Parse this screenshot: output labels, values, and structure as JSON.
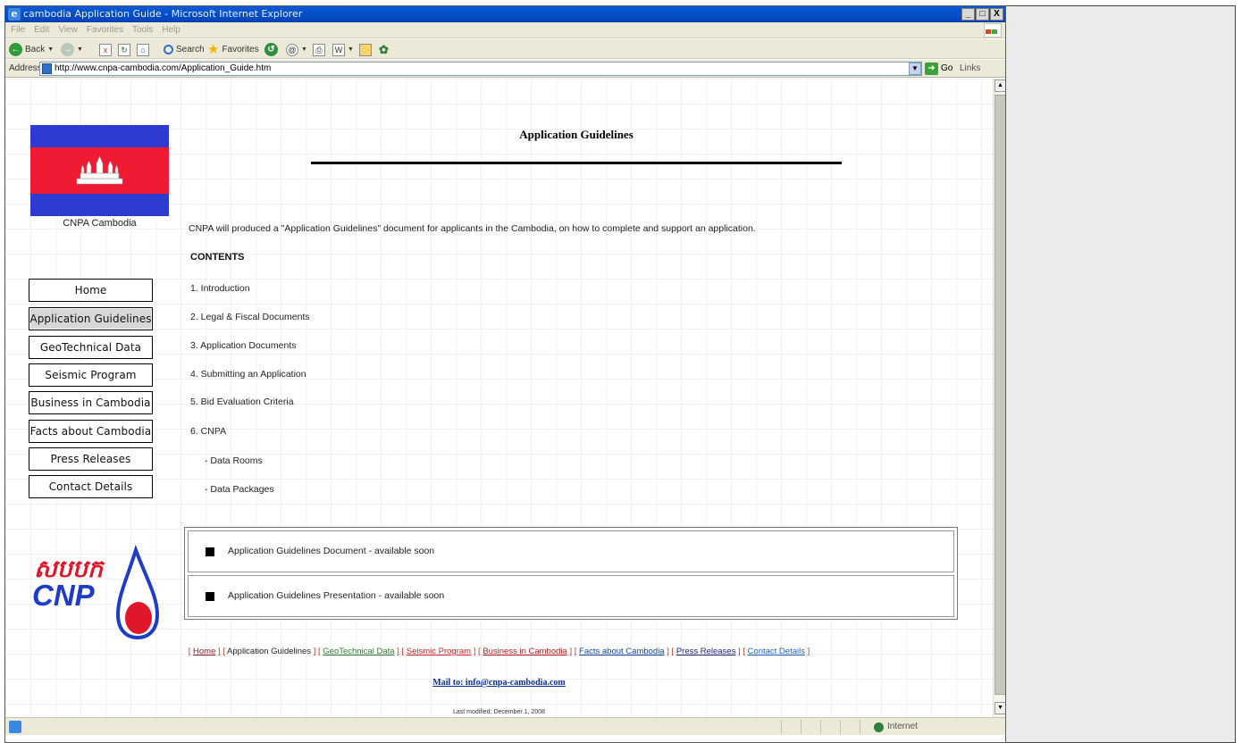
{
  "window": {
    "title": "cambodia Application Guide - Microsoft Internet Explorer",
    "controls": [
      "_",
      "□",
      "X"
    ]
  },
  "menubar": [
    "File",
    "Edit",
    "View",
    "Favorites",
    "Tools",
    "Help"
  ],
  "toolbar": {
    "back_label": "Back",
    "search_label": "Search",
    "favorites_label": "Favorites"
  },
  "address": {
    "label": "Address",
    "url": "http://www.cnpa-cambodia.com/Application_Guide.htm",
    "go_label": "Go",
    "links_label": "Links"
  },
  "page": {
    "flag_caption": "CNPA Cambodia",
    "heading": "Application Guidelines",
    "intro": "CNPA will produced a \"Application Guidelines\" document for applicants in the Cambodia, on how to complete and support an application.",
    "contents_title": "CONTENTS",
    "toc": [
      "1. Introduction",
      "2. Legal & Fiscal Documents",
      "3. Application Documents",
      "4. Submitting an Application",
      "5. Bid Evaluation Criteria",
      "6. CNPA",
      "- Data Rooms",
      "- Data Packages"
    ],
    "documents": [
      "Application Guidelines Document - available soon",
      "Application Guidelines Presentation - available soon"
    ],
    "logo": {
      "khmer": "សបបក",
      "latin": "CNP"
    },
    "footer_links": {
      "home": "Home",
      "app": "Application Guidelines",
      "geo": "GeoTechnical Data",
      "seismic": "Seismic Program",
      "business": "Business in Cambodia",
      "facts": "Facts about Cambodia",
      "press": "Press Releases",
      "contact": "Contact Details"
    },
    "mail": "Mail to:  info@cnpa-cambodia.com",
    "modified": "Last modified: December 1, 2008"
  },
  "nav": [
    {
      "label": "Home",
      "active": false
    },
    {
      "label": "Application Guidelines",
      "active": true
    },
    {
      "label": "GeoTechnical Data",
      "active": false
    },
    {
      "label": "Seismic Program",
      "active": false
    },
    {
      "label": "Business in Cambodia",
      "active": false
    },
    {
      "label": "Facts about Cambodia",
      "active": false
    },
    {
      "label": "Press Releases",
      "active": false
    },
    {
      "label": "Contact Details",
      "active": false
    }
  ],
  "status": {
    "zone": "Internet"
  },
  "colors": {
    "titlebar": "#0a5ad8",
    "flag_blue": "#2e3bd0",
    "flag_red": "#f01a32",
    "logo_red": "#e0162b",
    "logo_blue": "#1e3cc8"
  }
}
